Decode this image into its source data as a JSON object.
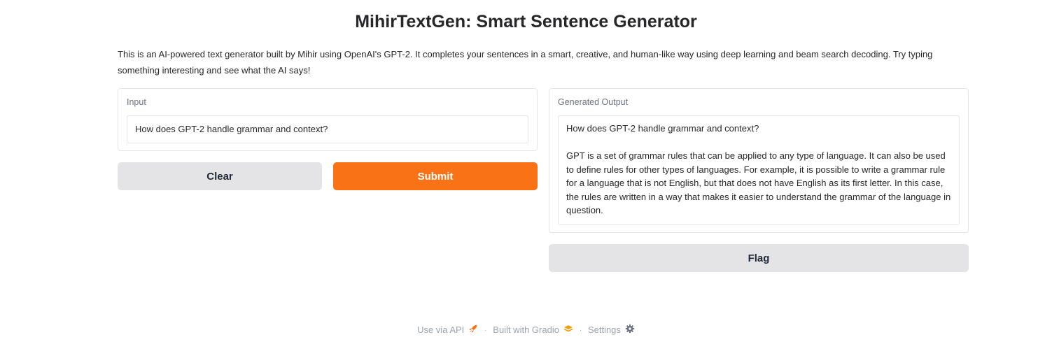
{
  "header": {
    "title": "MihirTextGen: Smart Sentence Generator",
    "description": "This is an AI-powered text generator built by Mihir using OpenAI's GPT-2. It completes your sentences in a smart, creative, and human-like way using deep learning and beam search decoding. Try typing something interesting and see what the AI says!"
  },
  "input": {
    "label": "Input",
    "value": "How does GPT-2 handle grammar and context?"
  },
  "output": {
    "label": "Generated Output",
    "value": "How does GPT-2 handle grammar and context?\n\nGPT is a set of grammar rules that can be applied to any type of language. It can also be used to define rules for other types of languages. For example, it is possible to write a grammar rule for a language that is not English, but that does not have English as its first letter. In this case, the rules are written in a way that makes it easier to understand the grammar of the language in question."
  },
  "buttons": {
    "clear": "Clear",
    "submit": "Submit",
    "flag": "Flag"
  },
  "footer": {
    "api": "Use via API",
    "built": "Built with Gradio",
    "settings": "Settings",
    "separator": "·"
  },
  "colors": {
    "primary": "#f97316",
    "secondary": "#e4e4e7"
  }
}
